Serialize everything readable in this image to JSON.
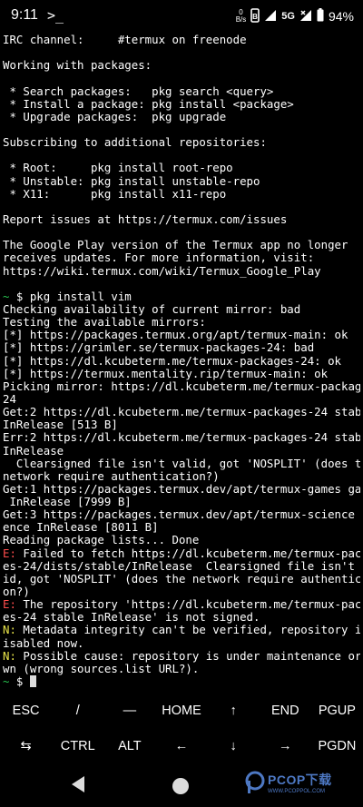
{
  "status_bar": {
    "time": "9:11",
    "prompt_glyph": ">_",
    "net_speed_value": "0",
    "net_speed_unit": "B/s",
    "network_type": "5G",
    "battery": "94%",
    "icons": [
      "terminal-notification-icon",
      "data-saver-icon",
      "signal-icon",
      "signal-x-icon",
      "battery-icon"
    ]
  },
  "terminal": {
    "colors": {
      "error": "#ff4d4d",
      "note": "#e7e34a",
      "prompt": "#27c14e"
    },
    "lines": [
      "IRC channel:     #termux on freenode",
      "",
      "Working with packages:",
      "",
      " * Search packages:   pkg search <query>",
      " * Install a package: pkg install <package>",
      " * Upgrade packages:  pkg upgrade",
      "",
      "Subscribing to additional repositories:",
      "",
      " * Root:     pkg install root-repo",
      " * Unstable: pkg install unstable-repo",
      " * X11:      pkg install x11-repo",
      "",
      "Report issues at https://termux.com/issues",
      "",
      "The Google Play version of the Termux app no longer",
      "receives updates. For more information, visit:",
      "https://wiki.termux.com/wiki/Termux_Google_Play",
      "",
      "~ $ pkg install vim",
      "Checking availability of current mirror: bad",
      "Testing the available mirrors:",
      "[*] https://packages.termux.org/apt/termux-main: ok",
      "[*] https://grimler.se/termux-packages-24: bad",
      "[*] https://dl.kcubeterm.me/termux-packages-24: ok",
      "[*] https://termux.mentality.rip/termux-main: ok",
      "Picking mirror: https://dl.kcubeterm.me/termux-packages-",
      "24",
      "Get:2 https://dl.kcubeterm.me/termux-packages-24 stable",
      "InRelease [513 B]",
      "Err:2 https://dl.kcubeterm.me/termux-packages-24 stable",
      "InRelease",
      "  Clearsigned file isn't valid, got 'NOSPLIT' (does the",
      "network require authentication?)",
      "Get:1 https://packages.termux.dev/apt/termux-games games",
      " InRelease [7999 B]",
      "Get:3 https://packages.termux.dev/apt/termux-science sci",
      "ence InRelease [8011 B]",
      "Reading package lists... Done",
      "E: Failed to fetch https://dl.kcubeterm.me/termux-packag",
      "es-24/dists/stable/InRelease  Clearsigned file isn't val",
      "id, got 'NOSPLIT' (does the network require authenticati",
      "on?)",
      "E: The repository 'https://dl.kcubeterm.me/termux-packag",
      "es-24 stable InRelease' is not signed.",
      "N: Metadata integrity can't be verified, repository is d",
      "isabled now.",
      "N: Possible cause: repository is under maintenance or do",
      "wn (wrong sources.list URL?).",
      "~ $ "
    ]
  },
  "extra_keys": {
    "row1": [
      "ESC",
      "/",
      "—",
      "HOME",
      "↑",
      "END",
      "PGUP"
    ],
    "row2": [
      "⇆",
      "CTRL",
      "ALT",
      "←",
      "↓",
      "→",
      "PGDN"
    ]
  },
  "nav_bar": {
    "icons": [
      "back-icon",
      "home-icon"
    ],
    "watermark_text": "PCOP下载",
    "watermark_sub": "WWW.PCOPPOL.COM"
  }
}
